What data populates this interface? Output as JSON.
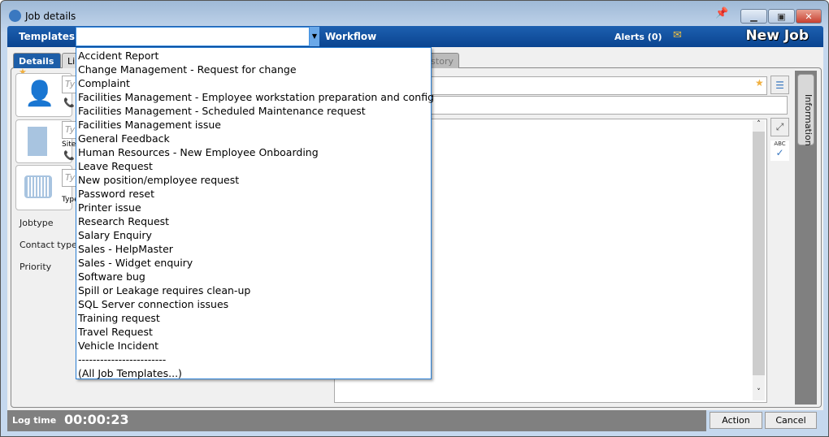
{
  "window": {
    "title": "Job details"
  },
  "toolbar": {
    "templates_label": "Templates",
    "template_value": "",
    "workflow_label": "Workflow",
    "alerts_label": "Alerts (0)",
    "mode_title": "New Job"
  },
  "tabs": [
    {
      "label": "Details"
    },
    {
      "label": "Li"
    },
    {
      "label": "istory"
    }
  ],
  "left": {
    "placeholder": "Ty",
    "site_label": "Site",
    "type_label": "Type",
    "jobtype_label": "Jobtype",
    "contacttype_label": "Contact type",
    "priority_label": "Priority"
  },
  "side_panel": {
    "label": "Information"
  },
  "dropdown": {
    "items": [
      "Accident Report",
      "Change Management - Request for change",
      "Complaint",
      "Facilities Management - Employee workstation preparation and config",
      "Facilities Management - Scheduled Maintenance request",
      "Facilities Management issue",
      "General Feedback",
      "Human Resources - New Employee Onboarding",
      "Leave Request",
      "New position/employee request",
      "Password reset",
      "Printer issue",
      "Research Request",
      "Salary Enquiry",
      "Sales - HelpMaster",
      "Sales - Widget enquiry",
      "Software bug",
      "Spill or Leakage requires clean-up",
      "SQL Server connection issues",
      "Training request",
      "Travel Request",
      "Vehicle Incident",
      "------------------------",
      "(All Job Templates...)"
    ]
  },
  "footer": {
    "log_time_label": "Log time",
    "log_time": "00:00:23",
    "action_label": "Action",
    "cancel_label": "Cancel"
  },
  "colors": {
    "toolbar": "#0a4490",
    "accent": "#2a7fd4",
    "footer": "#808080"
  }
}
